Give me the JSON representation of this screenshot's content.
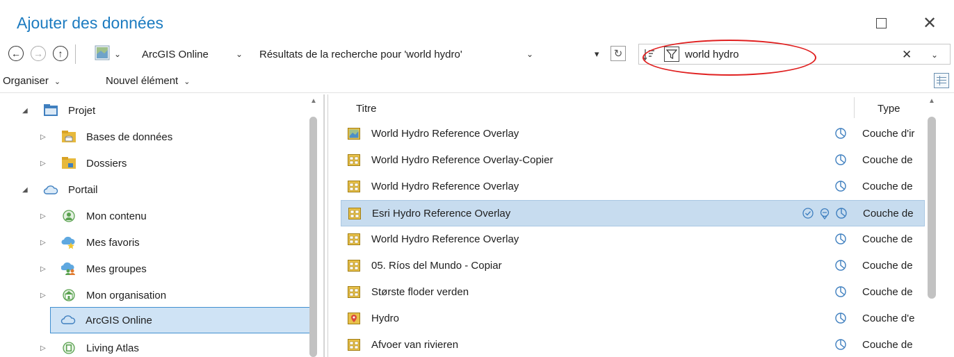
{
  "window": {
    "title": "Ajouter des données",
    "maximize_label": "",
    "close_label": "✕"
  },
  "navbar": {
    "back_icon": "arrow-left-icon",
    "forward_icon": "arrow-right-icon",
    "up_icon": "arrow-up-icon",
    "location_chevron": "⌄",
    "location": "ArcGIS Online",
    "breadcrumb": "Résultats de la recherche pour 'world hydro'",
    "dropdown_arrow": "▾",
    "refresh_glyph": "↻",
    "search_value": "world hydro",
    "search_clear": "✕"
  },
  "toolbar": {
    "organize": "Organiser",
    "new_item": "Nouvel élément"
  },
  "tree": {
    "items": [
      {
        "label": "Projet",
        "icon": "project-icon",
        "expanded": true
      },
      {
        "label": "Bases de données",
        "icon": "databases-icon",
        "expanded": false
      },
      {
        "label": "Dossiers",
        "icon": "folders-icon",
        "expanded": false
      },
      {
        "label": "Portail",
        "icon": "portal-icon",
        "expanded": true
      },
      {
        "label": "Mon contenu",
        "icon": "my-content-icon",
        "expanded": false
      },
      {
        "label": "Mes favoris",
        "icon": "favorites-icon",
        "expanded": false
      },
      {
        "label": "Mes groupes",
        "icon": "groups-icon",
        "expanded": false
      },
      {
        "label": "Mon organisation",
        "icon": "organization-icon",
        "expanded": false
      },
      {
        "label": "ArcGIS Online",
        "icon": "cloud-icon",
        "selected": true
      },
      {
        "label": "Living Atlas",
        "icon": "living-atlas-icon",
        "expanded": false
      }
    ]
  },
  "list": {
    "columns": {
      "title": "Titre",
      "type": "Type"
    },
    "rows": [
      {
        "title": "World Hydro Reference Overlay",
        "type": "Couche d'ir",
        "icon": "image-layer-icon",
        "selected": false
      },
      {
        "title": "World Hydro Reference Overlay-Copier",
        "type": "Couche de",
        "icon": "tile-layer-icon",
        "selected": false
      },
      {
        "title": "World Hydro Reference Overlay",
        "type": "Couche de",
        "icon": "tile-layer-icon",
        "selected": false
      },
      {
        "title": "Esri Hydro Reference Overlay",
        "type": "Couche de",
        "icon": "tile-layer-icon",
        "selected": true
      },
      {
        "title": "World Hydro Reference Overlay",
        "type": "Couche de",
        "icon": "tile-layer-icon",
        "selected": false
      },
      {
        "title": "05. Ríos del Mundo - Copiar",
        "type": "Couche de",
        "icon": "tile-layer-icon",
        "selected": false
      },
      {
        "title": "Største floder verden",
        "type": "Couche de",
        "icon": "tile-layer-icon",
        "selected": false
      },
      {
        "title": "Hydro",
        "type": "Couche d'e",
        "icon": "feature-layer-icon",
        "selected": false
      },
      {
        "title": "Afvoer van rivieren",
        "type": "Couche de",
        "icon": "tile-layer-icon",
        "selected": false
      }
    ]
  },
  "colors": {
    "accent": "#1c7bc0",
    "selection": "#c7dcef",
    "highlight_ring": "#e02020"
  }
}
